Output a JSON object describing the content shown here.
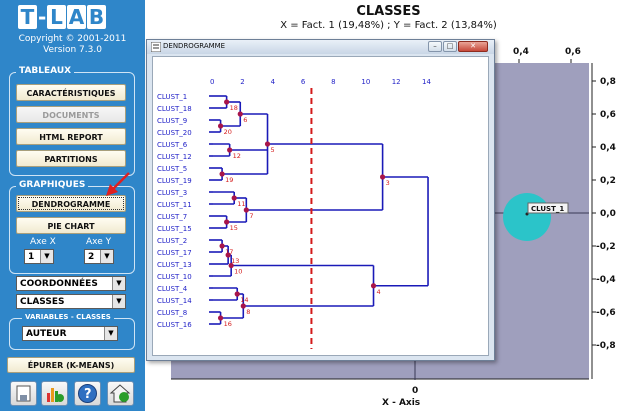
{
  "app": {
    "logo": [
      "T",
      "-",
      "L",
      "A",
      "B"
    ],
    "copyright": "Copyright © 2001-2011",
    "version": "Version 7.3.0"
  },
  "sidebar": {
    "tableaux_title": "TABLEAUX",
    "tableaux_buttons": [
      "CARACTÉRISTIQUES",
      "DOCUMENTS",
      "HTML REPORT",
      "PARTITIONS"
    ],
    "graphiques_title": "GRAPHIQUES",
    "graphiques_buttons": [
      "DENDROGRAMME",
      "PIE CHART"
    ],
    "axe_x_label": "Axe X",
    "axe_x_value": "1",
    "axe_y_label": "Axe Y",
    "axe_y_value": "2",
    "coord_select": "COORDONNÉES",
    "classes_select": "CLASSES",
    "variables_title": "VARIABLES - CLASSES",
    "variables_select": "AUTEUR",
    "epurer_button": "ÉPURER (K-MEANS)",
    "bottom_icons": [
      "save-icon",
      "bar-chart-icon",
      "help-icon",
      "home-icon"
    ],
    "highlight_color": "#e02020"
  },
  "plot": {
    "title": "CLASSES",
    "subtitle": "X = Fact. 1 (19,48%) ; Y = Fact. 2 (13,84%)",
    "x_axis_label": "X - Axis",
    "x_ticks": [
      "0,4",
      "0,6"
    ],
    "x_zero": "0",
    "y_ticks": [
      "0,8",
      "0,6",
      "0,4",
      "0,2",
      "0,0",
      "-0,2",
      "-0,4",
      "-0,6",
      "-0,8"
    ],
    "point_label": "CLUST_1",
    "point_color": "#2bc4c9",
    "background_color": "#9f9fbd"
  },
  "dendrogram_window": {
    "title": "DENDROGRAMME",
    "buttons": [
      "minimize",
      "maximize",
      "close"
    ],
    "chart_data": {
      "type": "dendrogram",
      "x_ticks": [
        0,
        2,
        4,
        6,
        8,
        10,
        12,
        14
      ],
      "cut_line": 6.5,
      "leaves": [
        "CLUST_1",
        "CLUST_18",
        "CLUST_9",
        "CLUST_20",
        "CLUST_6",
        "CLUST_12",
        "CLUST_5",
        "CLUST_19",
        "CLUST_3",
        "CLUST_11",
        "CLUST_7",
        "CLUST_15",
        "CLUST_2",
        "CLUST_17",
        "CLUST_13",
        "CLUST_10",
        "CLUST_4",
        "CLUST_14",
        "CLUST_8",
        "CLUST_16"
      ],
      "nodes": [
        {
          "label": "18",
          "height": 0.9,
          "children": [
            "CLUST_1",
            "CLUST_18"
          ]
        },
        {
          "label": "20",
          "height": 0.5,
          "children": [
            "CLUST_9",
            "CLUST_20"
          ]
        },
        {
          "label": "6",
          "height": 1.8,
          "children": [
            "18",
            "20"
          ]
        },
        {
          "label": "12",
          "height": 1.1,
          "children": [
            "CLUST_6",
            "CLUST_12"
          ]
        },
        {
          "label": "19",
          "height": 0.6,
          "children": [
            "CLUST_5",
            "CLUST_19"
          ]
        },
        {
          "label": "5",
          "height": 3.6,
          "children": [
            "6",
            "12",
            "19"
          ]
        },
        {
          "label": "11",
          "height": 1.4,
          "children": [
            "CLUST_3",
            "CLUST_11"
          ]
        },
        {
          "label": "15",
          "height": 0.9,
          "children": [
            "CLUST_7",
            "CLUST_15"
          ]
        },
        {
          "label": "7",
          "height": 2.2,
          "children": [
            "11",
            "15"
          ]
        },
        {
          "label": "3",
          "height": 11.2,
          "children": [
            "5",
            "7"
          ]
        },
        {
          "label": "17",
          "height": 0.6,
          "children": [
            "CLUST_2",
            "CLUST_17"
          ]
        },
        {
          "label": "13",
          "height": 1.0,
          "children": [
            "17",
            "CLUST_13"
          ]
        },
        {
          "label": "10",
          "height": 1.2,
          "children": [
            "13",
            "CLUST_10"
          ]
        },
        {
          "label": "14",
          "height": 1.6,
          "children": [
            "CLUST_4",
            "CLUST_14"
          ]
        },
        {
          "label": "16",
          "height": 0.5,
          "children": [
            "CLUST_8",
            "CLUST_16"
          ]
        },
        {
          "label": "8",
          "height": 2.0,
          "children": [
            "14",
            "16"
          ]
        },
        {
          "label": "4",
          "height": 10.6,
          "children": [
            "10",
            "8"
          ]
        },
        {
          "label": "2",
          "height": 14.2,
          "children": [
            "3",
            "4"
          ]
        }
      ],
      "line_color": "#1a1ab8",
      "node_color": "#a8154a",
      "cut_color": "#d41a1a",
      "label_color": "#2323c8",
      "node_label_color": "#d41a1a"
    }
  }
}
